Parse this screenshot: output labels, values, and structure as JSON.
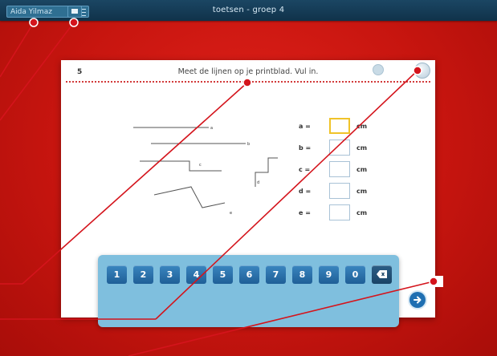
{
  "topbar": {
    "user_name": "Aida Yilmaz",
    "app_title": "toetsen - groep 4"
  },
  "question": {
    "number": "5",
    "instruction": "Meet de lijnen op je printblad. Vul in."
  },
  "figure_labels": [
    "a",
    "b",
    "c",
    "d",
    "e"
  ],
  "answers": [
    {
      "label": "a =",
      "value": "",
      "unit": "cm"
    },
    {
      "label": "b =",
      "value": "",
      "unit": "cm"
    },
    {
      "label": "c =",
      "value": "",
      "unit": "cm"
    },
    {
      "label": "d =",
      "value": "",
      "unit": "cm"
    },
    {
      "label": "e =",
      "value": "",
      "unit": "cm"
    }
  ],
  "keypad": {
    "keys": [
      "1",
      "2",
      "3",
      "4",
      "5",
      "6",
      "7",
      "8",
      "9",
      "0"
    ]
  },
  "colors": {
    "background": "#c7150f",
    "topbar": "#1b4663",
    "keypad": "#7fbfde",
    "key": "#1f5f97",
    "active_field": "#f0c329",
    "callout": "#d4141c"
  }
}
